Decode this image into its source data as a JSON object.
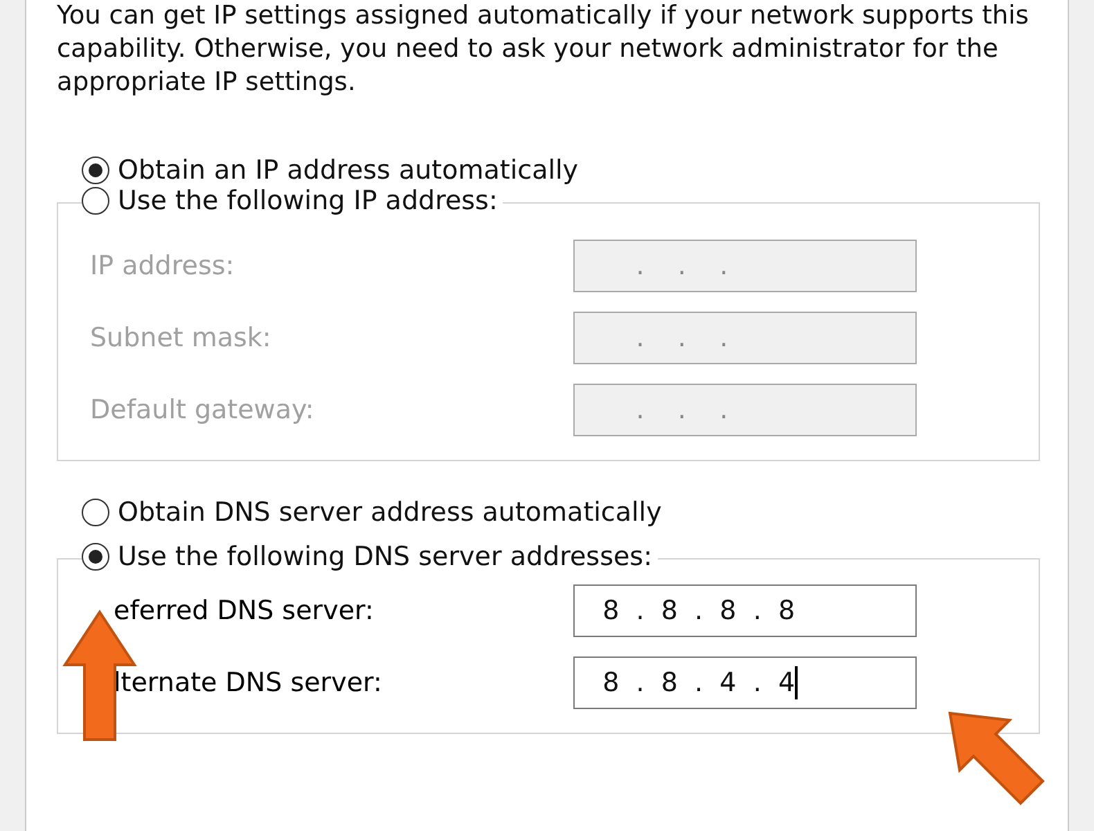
{
  "intro": "You can get IP settings assigned automatically if your network supports this capability. Otherwise, you need to ask your network administrator for the appropriate IP settings.",
  "ip_options": [
    {
      "label": "Obtain an IP address automatically",
      "selected": true
    },
    {
      "label": "Use the following IP address:",
      "selected": false
    }
  ],
  "ip_fields": [
    {
      "label": "IP address:",
      "value": "      .    .    .",
      "disabled": true,
      "caret": false
    },
    {
      "label": "Subnet mask:",
      "value": "      .    .    .",
      "disabled": true,
      "caret": false
    },
    {
      "label": "Default gateway:",
      "value": "      .    .    .",
      "disabled": true,
      "caret": false
    }
  ],
  "dns_options": [
    {
      "label": "Obtain DNS server address automatically",
      "selected": false
    },
    {
      "label": "Use the following DNS server addresses:",
      "selected": true
    }
  ],
  "dns_fields": [
    {
      "label": "eferred DNS server:",
      "value": "  8  .  8  .  8  .  8",
      "disabled": false,
      "caret": false
    },
    {
      "label": "lternate DNS server:",
      "value": "  8  .  8  .  4  .  4",
      "disabled": false,
      "caret": true
    }
  ]
}
